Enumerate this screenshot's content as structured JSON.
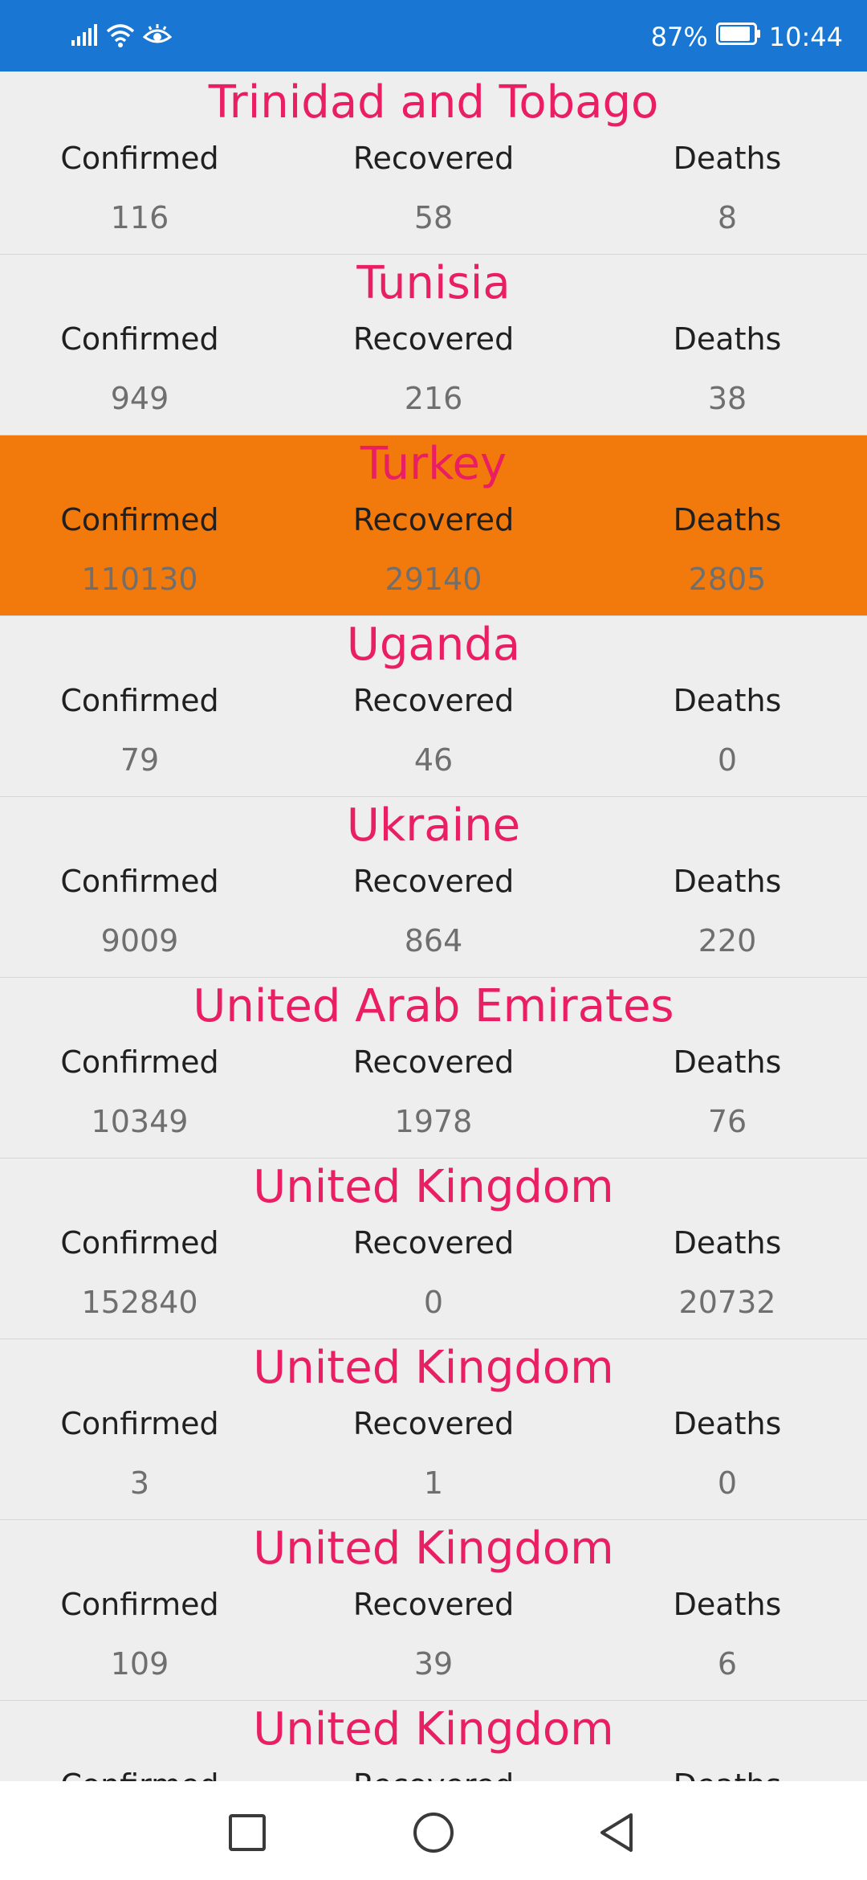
{
  "status_bar": {
    "battery_percent": "87%",
    "time": "10:44",
    "icons": [
      "signal-icon",
      "wifi-icon",
      "eye-comfort-icon",
      "battery-icon"
    ]
  },
  "labels": {
    "confirmed": "Confirmed",
    "recovered": "Recovered",
    "deaths": "Deaths"
  },
  "rows": [
    {
      "country": "Trinidad and Tobago",
      "confirmed": "116",
      "recovered": "58",
      "deaths": "8"
    },
    {
      "country": "Tunisia",
      "confirmed": "949",
      "recovered": "216",
      "deaths": "38"
    },
    {
      "country": "Turkey",
      "confirmed": "110130",
      "recovered": "29140",
      "deaths": "2805"
    },
    {
      "country": "Uganda",
      "confirmed": "79",
      "recovered": "46",
      "deaths": "0"
    },
    {
      "country": "Ukraine",
      "confirmed": "9009",
      "recovered": "864",
      "deaths": "220"
    },
    {
      "country": "United Arab Emirates",
      "confirmed": "10349",
      "recovered": "1978",
      "deaths": "76"
    },
    {
      "country": "United Kingdom",
      "confirmed": "152840",
      "recovered": "0",
      "deaths": "20732"
    },
    {
      "country": "United Kingdom",
      "confirmed": "3",
      "recovered": "1",
      "deaths": "0"
    },
    {
      "country": "United Kingdom",
      "confirmed": "109",
      "recovered": "39",
      "deaths": "6"
    },
    {
      "country": "United Kingdom",
      "confirmed": "",
      "recovered": "",
      "deaths": ""
    }
  ],
  "colors": {
    "status_bar": "#1976d2",
    "country_name": "#e91e63",
    "highlight_row": "#f27a0d",
    "background": "#eeeeee"
  },
  "navigation": {
    "icons": [
      "recent-apps-icon",
      "home-icon",
      "back-icon"
    ]
  }
}
